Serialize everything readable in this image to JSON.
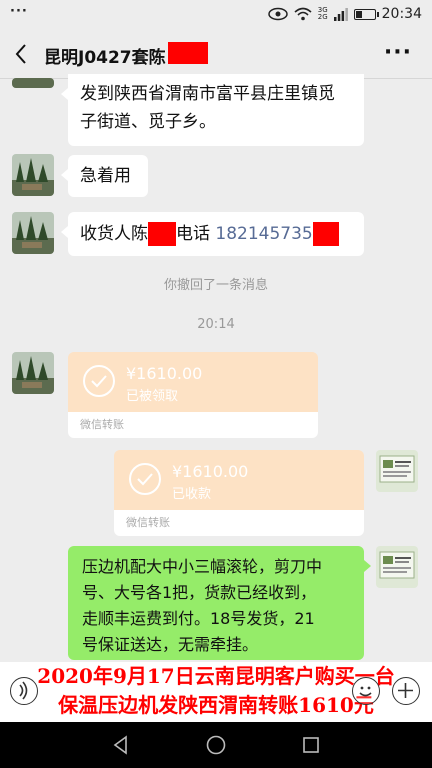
{
  "status_bar": {
    "time": "20:34",
    "dots": "···",
    "net_top": "3G",
    "net_bottom": "2G",
    "battery_level": 0.35
  },
  "header": {
    "title": "昆明J0427套陈",
    "more_label": "···"
  },
  "messages": {
    "address_line1": "发到陕西省渭南市富平县庄里镇觅",
    "address_line2": "子街道、觅子乡。",
    "urgent": "急着用",
    "receiver_prefix": "收货人陈",
    "receiver_mid": "电话",
    "receiver_phone": "182145735"
  },
  "recall_notice": "你撤回了一条消息",
  "timestamp": "20:14",
  "transfers": [
    {
      "amount": "¥1610.00",
      "status": "已被领取",
      "label": "微信转账"
    },
    {
      "amount": "¥1610.00",
      "status": "已收款",
      "label": "微信转账"
    }
  ],
  "sent_message": {
    "line1": "压边机配大中小三幅滚轮，剪刀中",
    "line2": "号、大号各1把，货款已经收到，",
    "line3": "走顺丰运费到付。18号发货，21",
    "line4": "号保证送达，无需牵挂。"
  },
  "caption": {
    "line1": "2020年9月17日云南昆明客户购买一台",
    "line2": "保温压边机发陕西渭南转账1610元"
  },
  "colors": {
    "bubble_green": "#95ec69",
    "transfer_bg": "#fde2c5",
    "redact": "#ff0000",
    "caption_text": "#ff0000"
  },
  "icons": [
    "eye-icon",
    "wifi-icon",
    "signal-icon",
    "battery-icon",
    "back-chevron-icon",
    "voice-icon",
    "emoji-icon",
    "plus-icon",
    "nav-back-icon",
    "nav-home-icon",
    "nav-recents-icon"
  ]
}
